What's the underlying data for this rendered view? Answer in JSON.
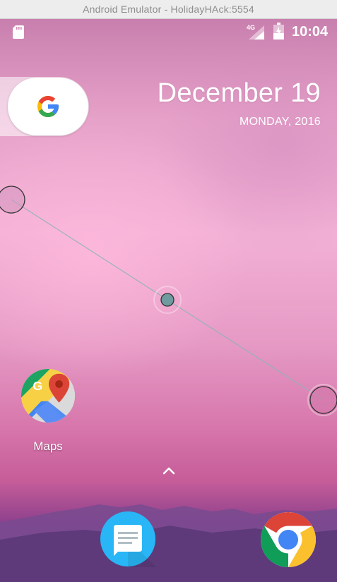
{
  "window": {
    "title": "Android Emulator - HolidayHAck:5554"
  },
  "status_bar": {
    "network_type": "4G",
    "time": "10:04",
    "icons": [
      "sd-card-icon",
      "cell-signal-icon",
      "battery-icon"
    ]
  },
  "search_widget": {
    "icon": "google-g-icon"
  },
  "date_widget": {
    "date": "December 19",
    "day_year": "MONDAY, 2016"
  },
  "home_apps": [
    {
      "label": "Maps",
      "icon": "google-maps-icon"
    }
  ],
  "app_drawer": {
    "icon": "chevron-up-icon"
  },
  "dock": {
    "apps": [
      {
        "name": "Messages",
        "icon": "messages-icon"
      },
      {
        "name": "Chrome",
        "icon": "chrome-icon"
      }
    ]
  },
  "colors": {
    "wallpaper_pink": "#f3b1d6",
    "wallpaper_purple": "#5e3a7a",
    "gesture_node": "#6e9aa0",
    "google_blue": "#4285F4",
    "google_red": "#EA4335",
    "google_yellow": "#FBBC05",
    "google_green": "#34A853",
    "messages_blue": "#29B6F6"
  }
}
